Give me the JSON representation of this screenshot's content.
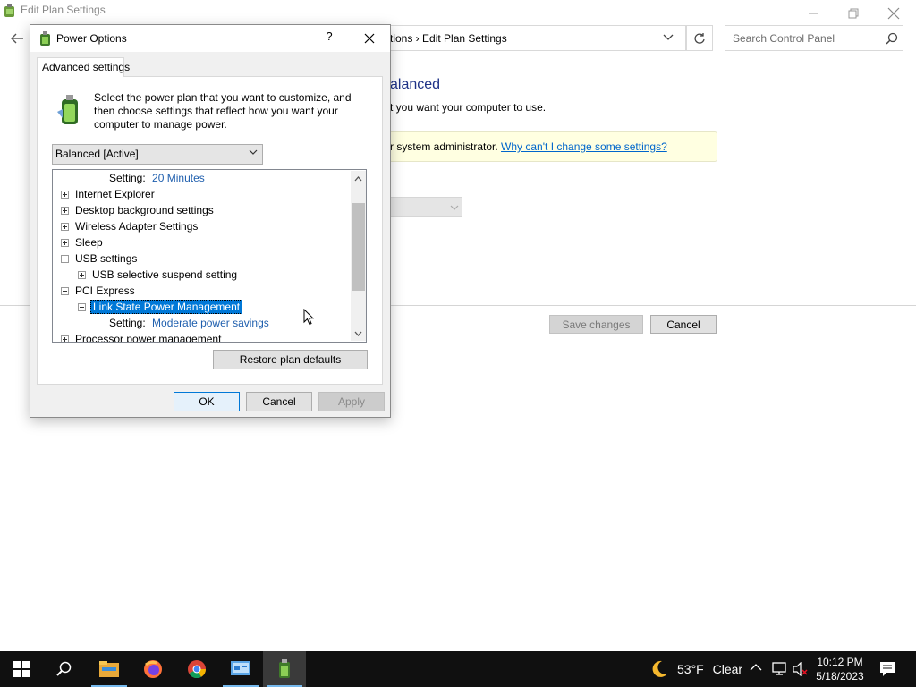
{
  "background_window": {
    "title": "Edit Plan Settings",
    "address": "tions  ›  Edit Plan Settings",
    "search_placeholder": "Search Control Panel",
    "plan_heading": "alanced",
    "plan_sub": "t you want your computer to use.",
    "admin_note": "r system administrator.",
    "admin_link": "Why can't I change some settings?",
    "save_label": "Save changes",
    "cancel_label": "Cancel"
  },
  "dialog": {
    "title": "Power Options",
    "help": "?",
    "tab": "Advanced settings",
    "intro": "Select the power plan that you want to customize, and then choose settings that reflect how you want your computer to manage power.",
    "plan_selected": "Balanced [Active]",
    "tree": {
      "setting1_label": "Setting:",
      "setting1_value": "20 Minutes",
      "internet_explorer": "Internet Explorer",
      "desktop_background": "Desktop background settings",
      "wireless_adapter": "Wireless Adapter Settings",
      "sleep": "Sleep",
      "usb_settings": "USB settings",
      "usb_selective": "USB selective suspend setting",
      "pci_express": "PCI Express",
      "link_state": "Link State Power Management",
      "setting2_label": "Setting:",
      "setting2_value": "Moderate power savings",
      "processor": "Processor power management"
    },
    "restore_label": "Restore plan defaults",
    "ok_label": "OK",
    "cancel_label": "Cancel",
    "apply_label": "Apply"
  },
  "taskbar": {
    "items": [
      "start-icon",
      "search-icon",
      "file-explorer-icon",
      "firefox-icon",
      "chrome-icon",
      "control-panel-icon",
      "power-options-icon"
    ],
    "weather_temp": "53°F",
    "weather_cond": "Clear",
    "time": "10:12 PM",
    "date": "5/18/2023"
  },
  "colors": {
    "accent": "#0078d7",
    "link": "#0066cc",
    "setting_value": "#1f5fae",
    "taskbar": "#101010"
  }
}
